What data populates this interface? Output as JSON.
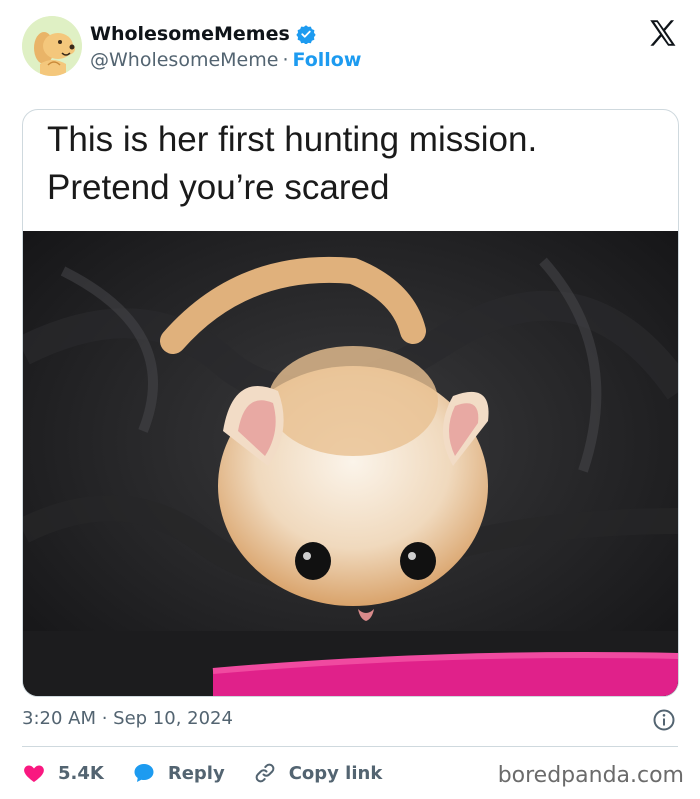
{
  "author": {
    "display_name": "WholesomeMemes",
    "handle": "@WholesomeMeme",
    "separator": "·",
    "follow_label": "Follow",
    "verified_color": "#1d9bf0"
  },
  "post": {
    "caption_line1": "This is her first hunting mission.",
    "caption_line2": "Pretend you’re scared",
    "timestamp": "3:20 AM · Sep 10, 2024"
  },
  "actions": {
    "likes": "5.4K",
    "reply_label": "Reply",
    "copy_link_label": "Copy link"
  },
  "watermark": "boredpanda.com",
  "colors": {
    "like": "#f91880",
    "reply": "#1d9bf0",
    "link": "#1d9bf0",
    "muted": "#536471"
  },
  "icons": [
    "x-logo-icon",
    "verified-icon",
    "info-icon",
    "heart-icon",
    "reply-icon",
    "link-icon"
  ]
}
